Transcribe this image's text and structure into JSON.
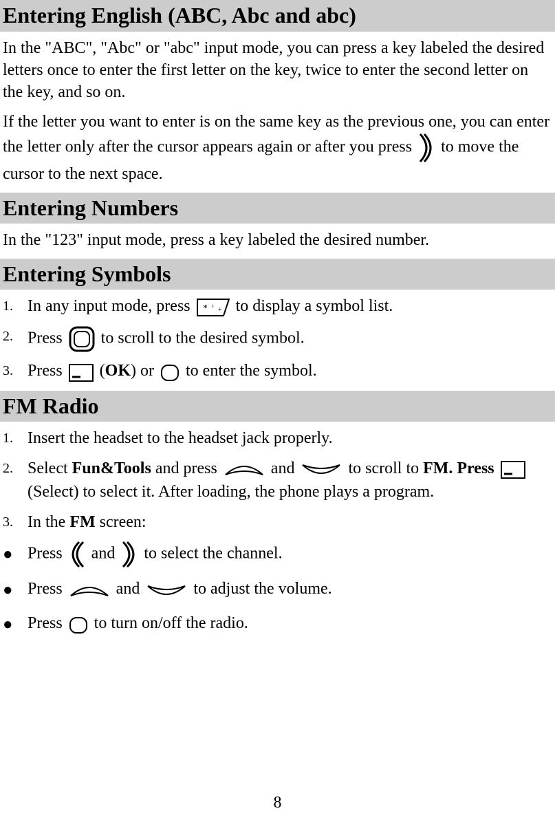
{
  "sections": {
    "english": {
      "title": "Entering English (ABC, Abc and abc)",
      "para1": "In the \"ABC\", \"Abc\" or \"abc\" input mode, you can press a key labeled the desired letters once to enter the first letter on the key, twice to enter the second letter on the key, and so on.",
      "para2_before": "If the letter you want to enter is on the same key as the previous one, you can enter the letter only after the cursor appears again or after you press ",
      "para2_after": " to move the cursor to the next space."
    },
    "numbers": {
      "title": "Entering Numbers",
      "para": "In the \"123\" input mode, press a key labeled the desired number."
    },
    "symbols": {
      "title": "Entering Symbols",
      "items": {
        "1": {
          "num": "1.",
          "before": "In any input mode, press ",
          "after": " to display a symbol list."
        },
        "2": {
          "num": "2.",
          "before": "Press ",
          "after": " to scroll to the desired symbol."
        },
        "3": {
          "num": "3.",
          "before": "Press ",
          "mid1": " (",
          "ok": "OK",
          "mid2": ") or ",
          "after": " to enter the symbol."
        }
      }
    },
    "fm": {
      "title": "FM Radio",
      "items": {
        "1": {
          "num": "1.",
          "text": "Insert the headset to the headset jack properly."
        },
        "2": {
          "num": "2.",
          "t1": "Select ",
          "b1": "Fun&Tools",
          "t2": " and press ",
          "t3": " and ",
          "t4": " to scroll to ",
          "b2": "FM. Press",
          "t5": " ",
          "t6": " (Select) to select it. After loading, the phone plays a program."
        },
        "3": {
          "num": "3.",
          "t1": "In the ",
          "b1": "FM",
          "t2": " screen:"
        }
      },
      "bullets": {
        "b": "●",
        "1": {
          "t1": "Press ",
          "t2": " and ",
          "t3": " to select the channel."
        },
        "2": {
          "t1": "Press ",
          "t2": " and ",
          "t3": " to adjust the volume."
        },
        "3": {
          "t1": "Press ",
          "t2": " to turn on/off the radio."
        }
      }
    }
  },
  "page_number": "8"
}
